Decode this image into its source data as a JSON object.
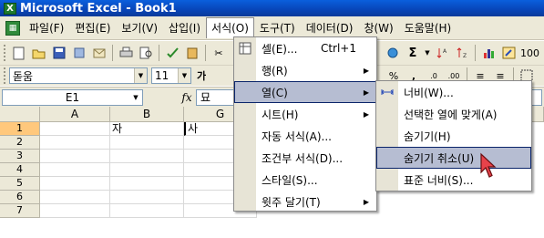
{
  "window": {
    "title": "Microsoft Excel - Book1",
    "app_icon": "X"
  },
  "menubar": {
    "items": [
      "파일(F)",
      "편집(E)",
      "보기(V)",
      "삽입(I)",
      "서식(O)",
      "도구(T)",
      "데이터(D)",
      "창(W)",
      "도움말(H)"
    ],
    "active": "서식(O)"
  },
  "toolbar": {
    "font_name": "돋움",
    "font_size": "11",
    "bold_label": "가",
    "zoom": "100"
  },
  "formula": {
    "name_box": "E1",
    "fx_label": "fx",
    "value": "묘"
  },
  "grid": {
    "columns": [
      "A",
      "B",
      "G"
    ],
    "rows": [
      "1",
      "2",
      "3",
      "4",
      "5",
      "6",
      "7"
    ],
    "cells": {
      "B1": "자",
      "G1": "사"
    }
  },
  "format_menu": {
    "items": [
      {
        "label": "셀(E)...",
        "shortcut": "Ctrl+1",
        "submenu": false
      },
      {
        "label": "행(R)",
        "shortcut": "",
        "submenu": true
      },
      {
        "label": "열(C)",
        "shortcut": "",
        "submenu": true,
        "highlighted": true
      },
      {
        "label": "시트(H)",
        "shortcut": "",
        "submenu": true
      },
      {
        "label": "자동 서식(A)...",
        "shortcut": "",
        "submenu": false
      },
      {
        "label": "조건부 서식(D)...",
        "shortcut": "",
        "submenu": false
      },
      {
        "label": "스타일(S)...",
        "shortcut": "",
        "submenu": false
      },
      {
        "label": "윗주 달기(T)",
        "shortcut": "",
        "submenu": true
      }
    ]
  },
  "column_submenu": {
    "items": [
      {
        "label": "너비(W)..."
      },
      {
        "label": "선택한 열에 맞게(A)"
      },
      {
        "label": "숨기기(H)"
      },
      {
        "label": "숨기기 취소(U)",
        "highlighted": true
      },
      {
        "label": "표준 너비(S)..."
      }
    ]
  },
  "colors": {
    "title_bar": "#0845b8",
    "menu_highlight": "#b6bdd2",
    "row_selected": "#ffc87c"
  }
}
